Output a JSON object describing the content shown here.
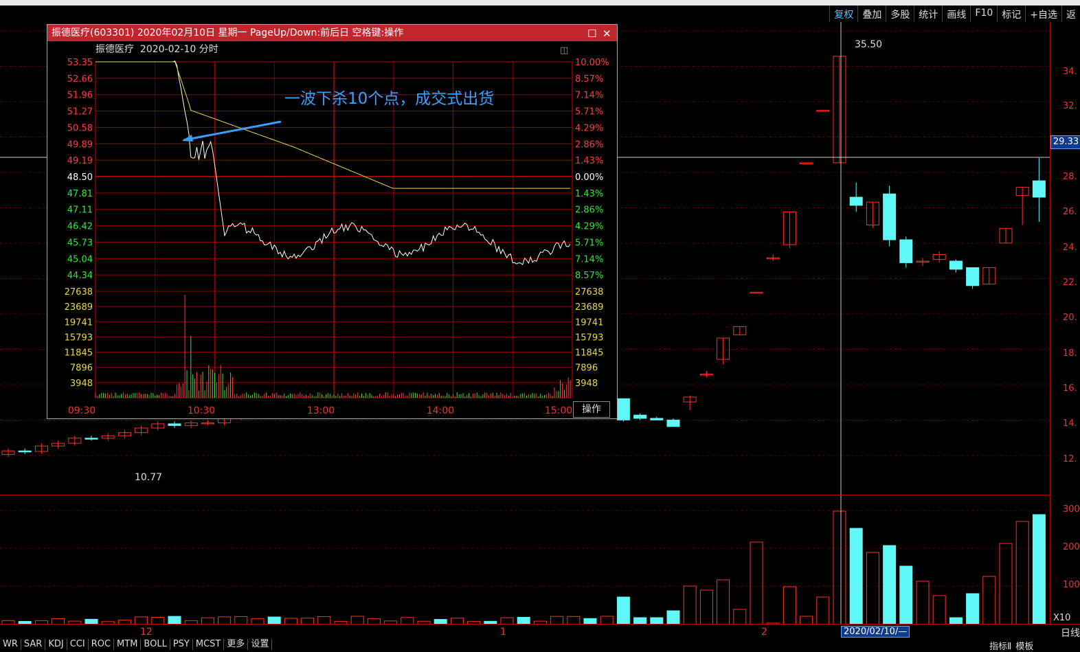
{
  "toolbar": {
    "items": [
      "复权",
      "叠加",
      "多股",
      "统计",
      "画线",
      "F10",
      "标记",
      "+自选",
      "返"
    ]
  },
  "main_chart": {
    "right_axis_labels": [
      "34.",
      "32.",
      "28.",
      "26.",
      "24.",
      "22.",
      "20.",
      "18.",
      "16.",
      "14.",
      "12."
    ],
    "current_price_tag": "29.33",
    "high_label": "35.50",
    "low_label": "10.77",
    "crosshair_price": 29.33,
    "y_min": 10,
    "y_max": 36
  },
  "volume_panel": {
    "axis_labels": [
      "300",
      "200",
      "100"
    ],
    "unit_label": "X10"
  },
  "date_axis": {
    "labels": [
      "12",
      "1",
      "2"
    ],
    "crosshair_date": "2020/02/10/—",
    "right_label": "日线"
  },
  "bottom_tabs": [
    "WR",
    "SAR",
    "KDJ",
    "CCI",
    "ROC",
    "MTM",
    "BOLL",
    "PSY",
    "MCST",
    "更多",
    "设置"
  ],
  "bottom_right": [
    "指标Ⅱ",
    "模板"
  ],
  "popup": {
    "title": "振德医疗(603301) 2020年02月10日 星期一 PageUp/Down:前后日 空格键:操作",
    "subtitle_name": "振德医疗",
    "subtitle_date": "2020-02-10",
    "subtitle_type": "分时",
    "operate_label": "操作",
    "annotation": "一波下杀10个点，成交式出货",
    "price_labels": [
      "53.35",
      "52.66",
      "51.96",
      "51.27",
      "50.58",
      "49.89",
      "49.19",
      "48.50",
      "47.81",
      "47.11",
      "46.42",
      "45.73",
      "45.04",
      "44.34"
    ],
    "pct_labels": [
      "10.00%",
      "8.57%",
      "7.14%",
      "5.71%",
      "4.29%",
      "2.86%",
      "1.43%",
      "0.00%",
      "1.43%",
      "2.86%",
      "4.29%",
      "5.71%",
      "7.14%",
      "8.57%"
    ],
    "vol_labels": [
      "27638",
      "23689",
      "19741",
      "15793",
      "11845",
      "7896",
      "3948"
    ],
    "time_labels": [
      "09:30",
      "10:30",
      "13:00",
      "14:00",
      "15:00"
    ],
    "colors": {
      "up": "#ff3b3b",
      "down": "#33e633",
      "flat": "#ffffff",
      "grid": "#b00000"
    }
  },
  "colors": {
    "up_candle": "#ff3030",
    "down_candle": "#5ff7f7",
    "axis": "#b00000"
  }
}
